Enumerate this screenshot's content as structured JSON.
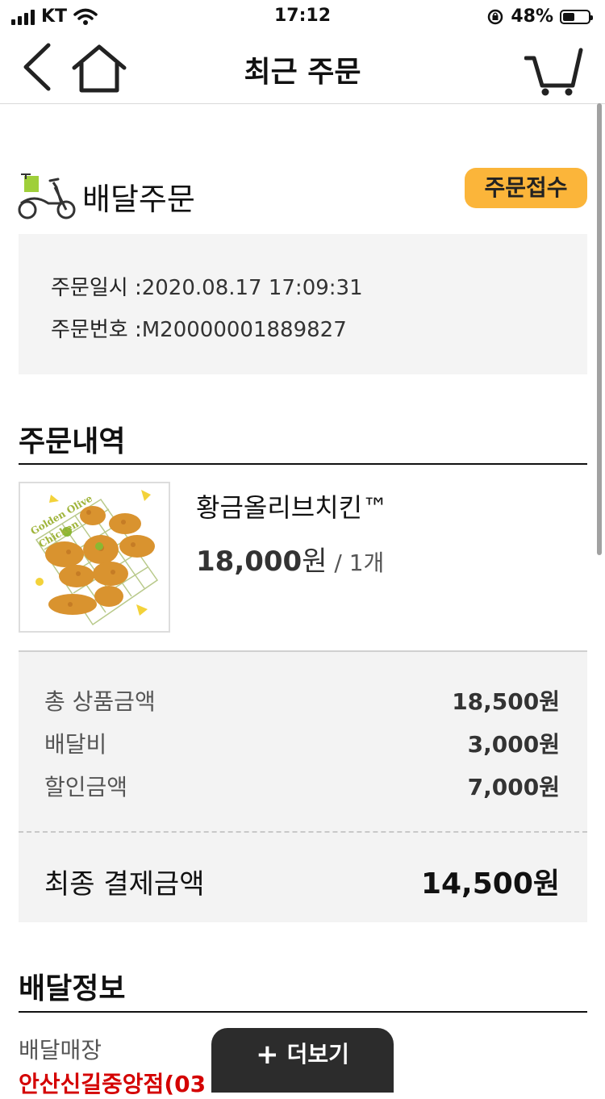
{
  "status_bar": {
    "carrier": "KT",
    "time": "17:12",
    "battery_text": "48%",
    "battery_level": 0.48
  },
  "header": {
    "title": "최근 주문"
  },
  "order": {
    "type_label": "배달주문",
    "status": "주문접수",
    "status_color": "#fbb53a",
    "datetime_label": "주문일시 :",
    "datetime": "2020.08.17 17:09:31",
    "number_label": "주문번호 :",
    "number": "M20000001889827"
  },
  "items_section": {
    "title": "주문내역",
    "items": [
      {
        "name": "황금올리브치킨™",
        "price": "18,000",
        "price_unit": "원",
        "qty": " / 1개",
        "image_text": "Golden Olive Chicken"
      }
    ]
  },
  "totals": {
    "rows": [
      {
        "label": "총 상품금액",
        "value": "18,500원"
      },
      {
        "label": "배달비",
        "value": "3,000원"
      },
      {
        "label": "할인금액",
        "value": "7,000원"
      }
    ],
    "final_label": "최종 결제금액",
    "final_value": "14,500원"
  },
  "delivery_section": {
    "title": "배달정보",
    "store_label": "배달매장",
    "store_name": "안산신길중앙점(03"
  },
  "more_button": {
    "label": "더보기"
  }
}
